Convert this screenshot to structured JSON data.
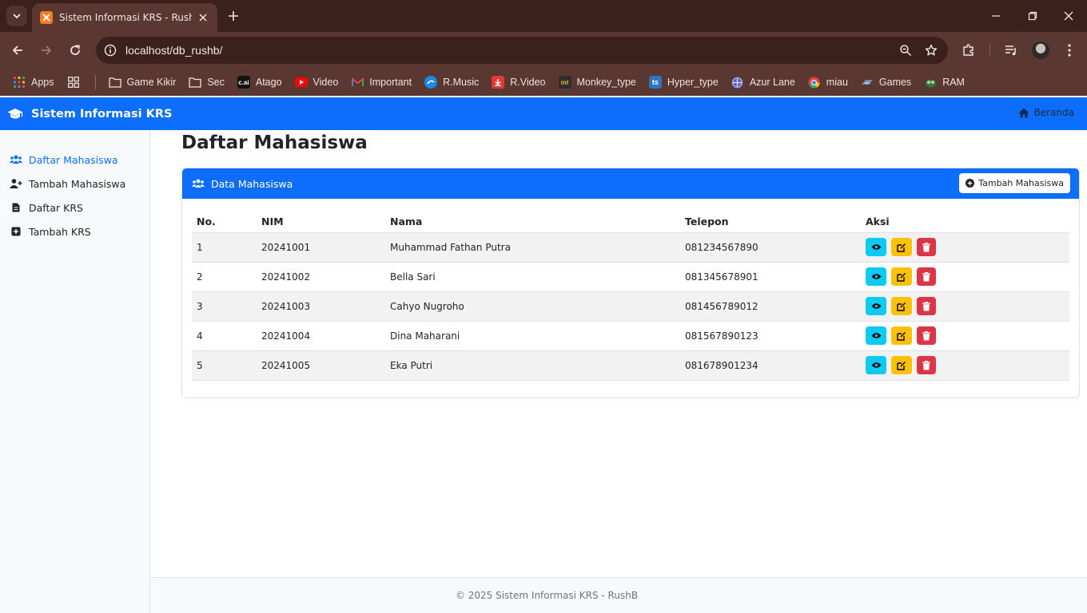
{
  "browser": {
    "tab_title": "Sistem Informasi KRS - RushB",
    "url": "localhost/db_rushb/",
    "bookmarks": [
      {
        "label": "Apps",
        "icon": "apps-grid-icon",
        "color": "#e94235"
      },
      {
        "label": "Game Kikir",
        "icon": "folder-icon",
        "color": "#efe3df"
      },
      {
        "label": "Sec",
        "icon": "folder-icon",
        "color": "#efe3df"
      },
      {
        "label": "Atago",
        "icon": "cai-icon",
        "color": "#111111"
      },
      {
        "label": "Video",
        "icon": "youtube-icon",
        "color": "#ff0000"
      },
      {
        "label": "Important",
        "icon": "gmail-icon",
        "color": "#ea4335"
      },
      {
        "label": "R.Music",
        "icon": "music-icon",
        "color": "#1e88e5"
      },
      {
        "label": "R.Video",
        "icon": "download-icon",
        "color": "#e53935"
      },
      {
        "label": "Monkey_type",
        "icon": "monkeytype-icon",
        "color": "#2c2e31"
      },
      {
        "label": "Hyper_type",
        "icon": "ts-icon",
        "color": "#2f74c0"
      },
      {
        "label": "Azur Lane",
        "icon": "azur-lane-icon",
        "color": "#7e7fd8"
      },
      {
        "label": "miau",
        "icon": "chrome-icon",
        "color": "#4285f4"
      },
      {
        "label": "Games",
        "icon": "games-icon",
        "color": "#6e8cb8"
      },
      {
        "label": "RAM",
        "icon": "ram-icon",
        "color": "#2e7d32"
      }
    ]
  },
  "navbar": {
    "brand": "Sistem Informasi KRS",
    "home_link": "Beranda"
  },
  "sidebar": {
    "items": [
      {
        "label": "Daftar Mahasiswa",
        "icon": "users-icon",
        "active": true
      },
      {
        "label": "Tambah Mahasiswa",
        "icon": "user-plus-icon",
        "active": false
      },
      {
        "label": "Daftar KRS",
        "icon": "file-icon",
        "active": false
      },
      {
        "label": "Tambah KRS",
        "icon": "plus-square-icon",
        "active": false
      }
    ]
  },
  "main": {
    "title": "Daftar Mahasiswa",
    "card_title": "Data Mahasiswa",
    "add_button": "Tambah Mahasiswa",
    "columns": [
      "No.",
      "NIM",
      "Nama",
      "Telepon",
      "Aksi"
    ],
    "rows": [
      {
        "no": "1",
        "nim": "20241001",
        "nama": "Muhammad Fathan Putra",
        "telepon": "081234567890"
      },
      {
        "no": "2",
        "nim": "20241002",
        "nama": "Bella Sari",
        "telepon": "081345678901"
      },
      {
        "no": "3",
        "nim": "20241003",
        "nama": "Cahyo Nugroho",
        "telepon": "081456789012"
      },
      {
        "no": "4",
        "nim": "20241004",
        "nama": "Dina Maharani",
        "telepon": "081567890123"
      },
      {
        "no": "5",
        "nim": "20241005",
        "nama": "Eka Putri",
        "telepon": "081678901234"
      }
    ]
  },
  "footer": {
    "text": "© 2025 Sistem Informasi KRS - RushB"
  },
  "colors": {
    "primary": "#0d6efd",
    "info": "#0dcaf0",
    "warning": "#ffc107",
    "danger": "#dc3545"
  }
}
